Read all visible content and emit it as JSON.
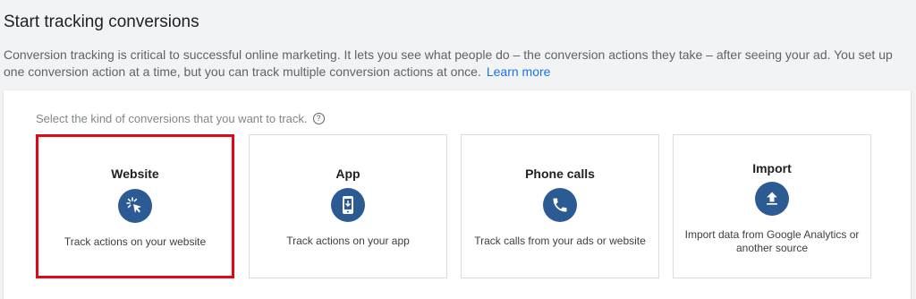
{
  "header": {
    "title": "Start tracking conversions",
    "intro": "Conversion tracking is critical to successful online marketing. It lets you see what people do – the conversion actions they take – after seeing your ad. You set up one conversion action at a time, but you can track multiple conversion actions at once.",
    "learn_more": "Learn more"
  },
  "panel": {
    "prompt": "Select the kind of conversions that you want to track.",
    "help_glyph": "?",
    "cards": [
      {
        "title": "Website",
        "description": "Track actions on your website",
        "icon": "click-cursor-icon",
        "selected": true
      },
      {
        "title": "App",
        "description": "Track actions on your app",
        "icon": "mobile-phone-icon",
        "selected": false
      },
      {
        "title": "Phone calls",
        "description": "Track calls from your ads or website",
        "icon": "phone-icon",
        "selected": false
      },
      {
        "title": "Import",
        "description": "Import data from Google Analytics or another source",
        "icon": "upload-icon",
        "selected": false
      }
    ]
  },
  "colors": {
    "accent": "#1a73e8",
    "icon_fill": "#2c5a93",
    "selected_border": "#e30613"
  }
}
